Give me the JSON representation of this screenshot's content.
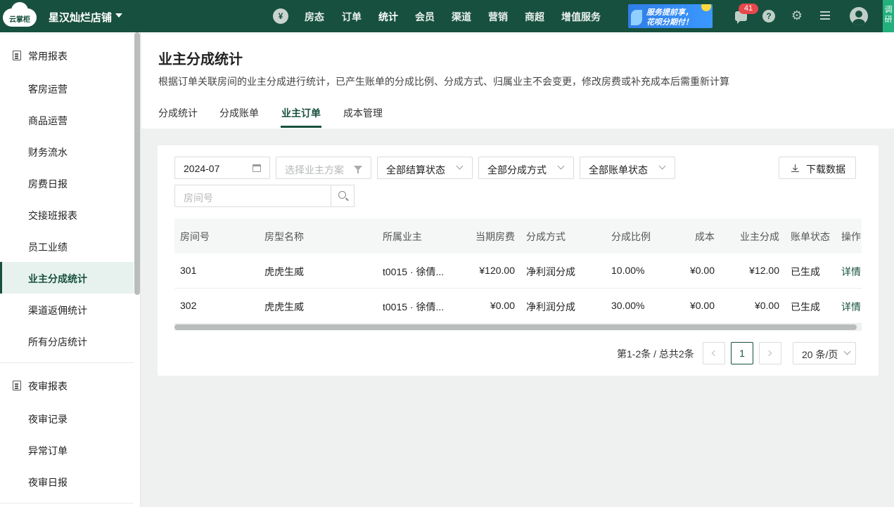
{
  "topbar": {
    "logo_text": "云掌柜",
    "store_name": "星汉灿烂店铺",
    "yen_symbol": "¥",
    "nav": [
      "房态",
      "订单",
      "统计",
      "会员",
      "渠道",
      "营销",
      "商超",
      "增值服务"
    ],
    "active_nav": "统计",
    "banner": {
      "line1": "服务提前享，",
      "line2": "花呗分期付！"
    },
    "notification_count": "41",
    "help_symbol": "?",
    "gear_symbol": "⚙",
    "survey_label": "调研"
  },
  "sidebar": {
    "groups": [
      {
        "label": "常用报表",
        "icon": "report-icon",
        "items": [
          "客房运营",
          "商品运营",
          "财务流水",
          "房费日报",
          "交接班报表",
          "员工业绩",
          "业主分成统计",
          "渠道返佣统计",
          "所有分店统计"
        ]
      },
      {
        "label": "夜审报表",
        "icon": "night-audit-icon",
        "items": [
          "夜审记录",
          "异常订单",
          "夜审日报"
        ]
      }
    ],
    "active_item": "业主分成统计"
  },
  "page": {
    "title": "业主分成统计",
    "description": "根据订单关联房间的业主分成进行统计，已产生账单的分成比例、分成方式、归属业主不会变更，修改房费或补充成本后需重新计算",
    "tabs": [
      "分成统计",
      "分成账单",
      "业主订单",
      "成本管理"
    ],
    "active_tab": "业主订单"
  },
  "filters": {
    "month": "2024-07",
    "owner_plan_placeholder": "选择业主方案",
    "settle_status": "全部结算状态",
    "split_method": "全部分成方式",
    "bill_status": "全部账单状态",
    "room_placeholder": "房间号",
    "download_label": "下载数据"
  },
  "table": {
    "columns": [
      "房间号",
      "房型名称",
      "所属业主",
      "当期房费",
      "分成方式",
      "分成比例",
      "成本",
      "业主分成",
      "账单状态",
      "操作"
    ],
    "rows": [
      [
        "301",
        "虎虎生威",
        "t0015 · 徐倩...",
        "¥120.00",
        "净利润分成",
        "10.00%",
        "¥0.00",
        "¥12.00",
        "已生成",
        "详情"
      ],
      [
        "302",
        "虎虎生威",
        "t0015 · 徐倩...",
        "¥0.00",
        "净利润分成",
        "30.00%",
        "¥0.00",
        "¥0.00",
        "已生成",
        "详情"
      ]
    ]
  },
  "pagination": {
    "total_text": "第1-2条 / 总共2条",
    "current_page": "1",
    "page_size": "20 条/页"
  },
  "colors": {
    "brand": "#17503e",
    "accent": "#23b07d",
    "badge": "#e5484d"
  }
}
